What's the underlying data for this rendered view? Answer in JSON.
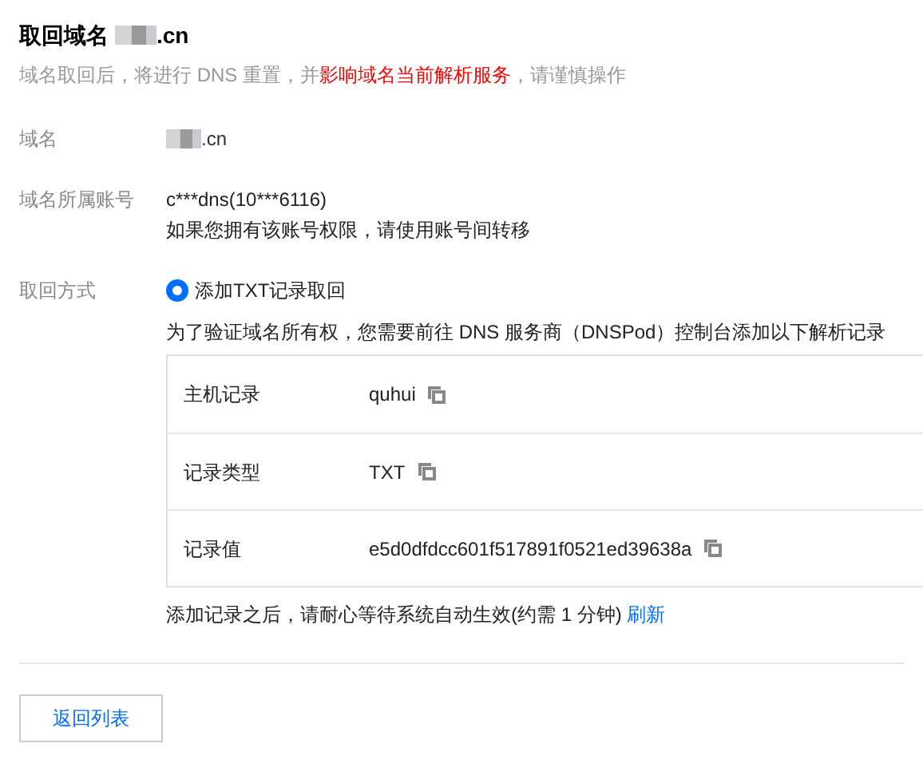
{
  "title": {
    "prefix": "取回域名",
    "suffix": ".cn"
  },
  "warning": [
    {
      "text": "域名取回后，将进行 DNS 重置，并",
      "highlight": false
    },
    {
      "text": "影响域名当前解析服务",
      "highlight": true
    },
    {
      "text": "，请谨慎操作",
      "highlight": false
    }
  ],
  "fields": [
    {
      "kind": "masked",
      "label": "域名",
      "suffix": ".cn"
    },
    {
      "kind": "lines",
      "label": "域名所属账号",
      "lines": [
        "c***dns(10***6116)",
        "如果您拥有该账号权限，请使用账号间转移"
      ]
    },
    {
      "kind": "method",
      "label": "取回方式",
      "option": {
        "label": "添加TXT记录取回",
        "selected": true
      },
      "instruction": "为了验证域名所有权，您需要前往 DNS 服务商（DNSPod）控制台添加以下解析记录",
      "records": [
        {
          "name": "主机记录",
          "value": "quhui"
        },
        {
          "name": "记录类型",
          "value": "TXT"
        },
        {
          "name": "记录值",
          "value": "e5d0dfdcc601f517891f0521ed39638a"
        }
      ],
      "note": "添加记录之后，请耐心等待系统自动生效(约需 1 分钟)",
      "link": "刷新"
    }
  ],
  "back_button": "返回列表"
}
